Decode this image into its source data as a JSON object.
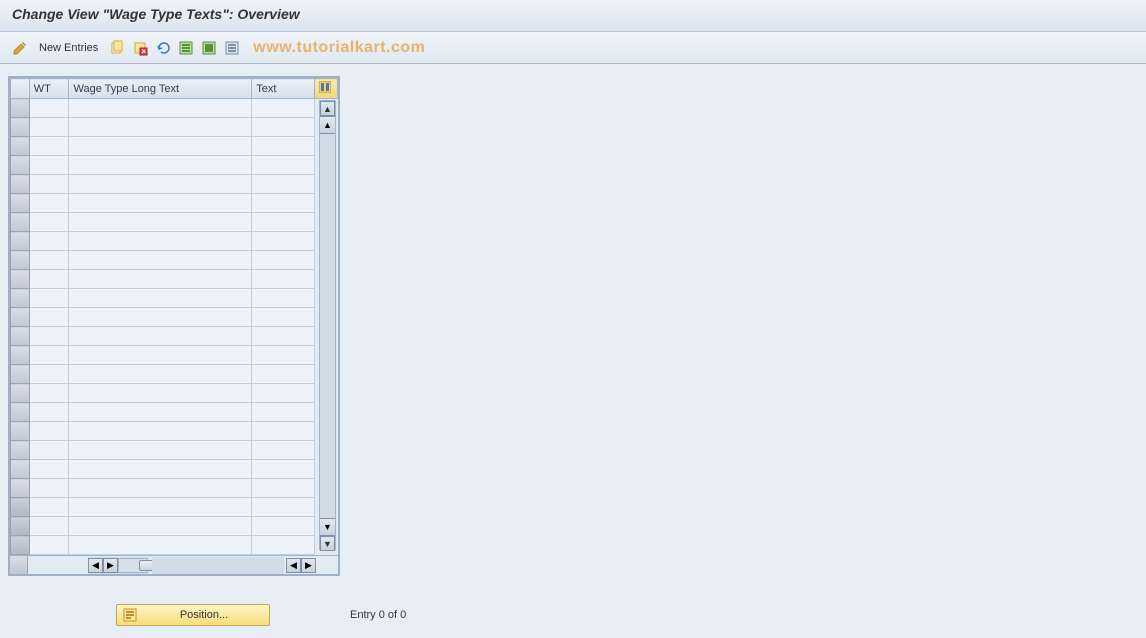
{
  "header": {
    "title": "Change View \"Wage Type Texts\": Overview"
  },
  "toolbar": {
    "new_entries_label": "New Entries",
    "watermark": "www.tutorialkart.com"
  },
  "table": {
    "columns": {
      "wt": "WT",
      "long": "Wage Type Long Text",
      "text": "Text"
    },
    "row_count": 24,
    "hscroll_thumb": ":::",
    "rows": []
  },
  "footer": {
    "position_label": "Position...",
    "entry_text": "Entry 0 of 0"
  },
  "icons": {
    "pencil": "pencil-icon",
    "copy": "copy-icon",
    "delete": "delete-icon",
    "undo": "undo-icon",
    "save_select": "select-all-icon",
    "select_block": "select-block-icon",
    "deselect": "deselect-icon",
    "config": "table-settings-icon",
    "position": "position-icon"
  }
}
